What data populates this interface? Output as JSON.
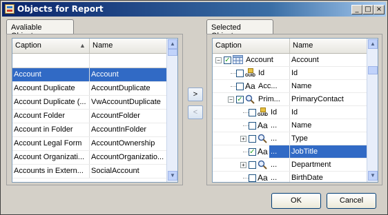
{
  "window": {
    "title": "Objects for Report",
    "controls": {
      "minimize": "_",
      "maximize": "□",
      "close": "×"
    }
  },
  "left_panel": {
    "tab_label": "Avaliable Objects",
    "columns": {
      "caption": "Caption",
      "name": "Name"
    },
    "sort_indicator": "▲",
    "rows": [
      {
        "caption": "Account",
        "name": "Account",
        "selected": true
      },
      {
        "caption": "Account Duplicate",
        "name": "AccountDuplicate"
      },
      {
        "caption": "Account Duplicate (...",
        "name": "VwAccountDuplicate"
      },
      {
        "caption": "Account Folder",
        "name": "AccountFolder"
      },
      {
        "caption": "Account in Folder",
        "name": "AccountInFolder"
      },
      {
        "caption": "Account Legal Form",
        "name": "AccountOwnership"
      },
      {
        "caption": "Account Organizati...",
        "name": "AccountOrganizatio..."
      },
      {
        "caption": "Accounts in Extern...",
        "name": "SocialAccount"
      }
    ]
  },
  "middle_buttons": {
    "add": ">",
    "remove": "<"
  },
  "right_panel": {
    "tab_label": "Selected Objects",
    "columns": {
      "caption": "Caption",
      "name": "Name"
    },
    "rows": [
      {
        "caption": "Account",
        "name": "Account",
        "icon": "table-icon",
        "checked": true
      },
      {
        "caption": "Id",
        "name": "Id",
        "icon": "guid-icon",
        "checked": false
      },
      {
        "caption": "Acc...",
        "name": "Name",
        "icon": "text-icon",
        "checked": false
      },
      {
        "caption": "Prim...",
        "name": "PrimaryContact",
        "icon": "lookup-icon",
        "checked": true
      },
      {
        "caption": "Id",
        "name": "Id",
        "icon": "guid-icon",
        "checked": false
      },
      {
        "caption": "...",
        "name": "Name",
        "icon": "text-icon",
        "checked": false
      },
      {
        "caption": "...",
        "name": "Type",
        "icon": "lookup-icon",
        "checked": false
      },
      {
        "caption": "...",
        "name": "JobTitle",
        "icon": "text-icon",
        "checked": true,
        "selected": true
      },
      {
        "caption": "...",
        "name": "Department",
        "icon": "lookup-icon",
        "checked": false
      },
      {
        "caption": "...",
        "name": "BirthDate",
        "icon": "text-icon",
        "checked": false
      }
    ],
    "icon_labels": {
      "guid": "GUID",
      "text": "Aa"
    }
  },
  "footer": {
    "ok_label": "OK",
    "cancel_label": "Cancel"
  },
  "colors": {
    "selection": "#316ac5",
    "title_bar": "#0a246a",
    "check": "#21a121"
  }
}
